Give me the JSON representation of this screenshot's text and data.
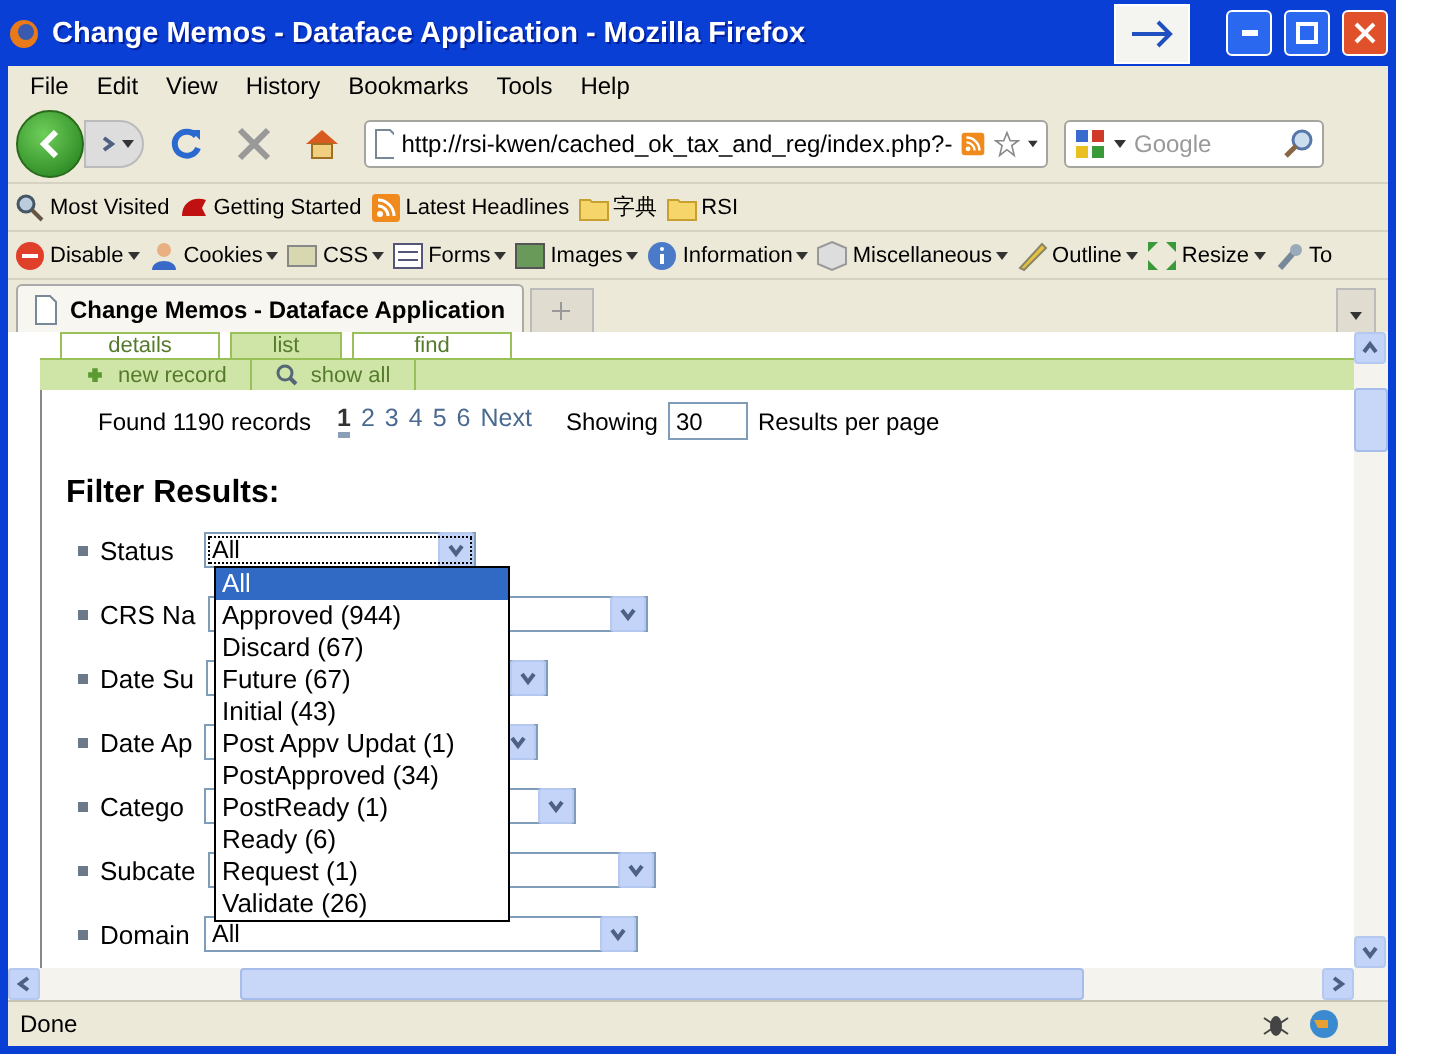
{
  "window": {
    "title": "Change Memos - Dataface Application - Mozilla Firefox"
  },
  "menu": [
    "File",
    "Edit",
    "View",
    "History",
    "Bookmarks",
    "Tools",
    "Help"
  ],
  "address": {
    "value": "http://rsi-kwen/cached_ok_tax_and_reg/index.php?-"
  },
  "search": {
    "placeholder": "Google"
  },
  "bookmarks": [
    {
      "label": "Most Visited",
      "kind": "search"
    },
    {
      "label": "Getting Started",
      "kind": "logo"
    },
    {
      "label": "Latest Headlines",
      "kind": "feed"
    },
    {
      "label": "字典",
      "kind": "folder"
    },
    {
      "label": "RSI",
      "kind": "folder"
    }
  ],
  "dev_toolbar": [
    {
      "label": "Disable",
      "kind": "stop"
    },
    {
      "label": "Cookies",
      "kind": "person"
    },
    {
      "label": "CSS",
      "kind": "css"
    },
    {
      "label": "Forms",
      "kind": "form"
    },
    {
      "label": "Images",
      "kind": "image"
    },
    {
      "label": "Information",
      "kind": "info"
    },
    {
      "label": "Miscellaneous",
      "kind": "box"
    },
    {
      "label": "Outline",
      "kind": "pen"
    },
    {
      "label": "Resize",
      "kind": "resize"
    },
    {
      "label": "To",
      "kind": "wrench"
    }
  ],
  "browser_tabs": [
    {
      "label": "Change Memos - Dataface Application",
      "selected": true
    }
  ],
  "app_tabs": [
    {
      "label": "details",
      "selected": false
    },
    {
      "label": "list",
      "selected": true
    },
    {
      "label": "find",
      "selected": false
    }
  ],
  "actions": [
    {
      "label": "new record",
      "kind": "add"
    },
    {
      "label": "show all",
      "kind": "search"
    }
  ],
  "results": {
    "found": "Found 1190 records",
    "pages": [
      {
        "label": "1",
        "selected": true
      },
      {
        "label": "2",
        "selected": false
      },
      {
        "label": "3",
        "selected": false
      },
      {
        "label": "4",
        "selected": false
      },
      {
        "label": "5",
        "selected": false
      },
      {
        "label": "6",
        "selected": false
      },
      {
        "label": "Next",
        "selected": false
      }
    ],
    "showing": "Showing",
    "per_page": "30",
    "per_page_suffix": "Results per page"
  },
  "filter": {
    "heading": "Filter Results:",
    "fields": [
      {
        "label": "Status",
        "value": "All"
      },
      {
        "label": "CRS Na"
      },
      {
        "label": "Date Su"
      },
      {
        "label": "Date Ap"
      },
      {
        "label": "Catego"
      },
      {
        "label": "Subcate"
      },
      {
        "label": "Domain",
        "value": "All"
      }
    ]
  },
  "status_dropdown": [
    {
      "label": "All",
      "selected": true
    },
    {
      "label": "Approved (944)",
      "selected": false
    },
    {
      "label": "Discard (67)",
      "selected": false
    },
    {
      "label": "Future (67)",
      "selected": false
    },
    {
      "label": "Initial (43)",
      "selected": false
    },
    {
      "label": "Post Appv Updat (1)",
      "selected": false
    },
    {
      "label": "PostApproved (34)",
      "selected": false
    },
    {
      "label": "PostReady (1)",
      "selected": false
    },
    {
      "label": "Ready (6)",
      "selected": false
    },
    {
      "label": "Request (1)",
      "selected": false
    },
    {
      "label": "Validate (26)",
      "selected": false
    }
  ],
  "status_bar": {
    "text": "Done"
  }
}
